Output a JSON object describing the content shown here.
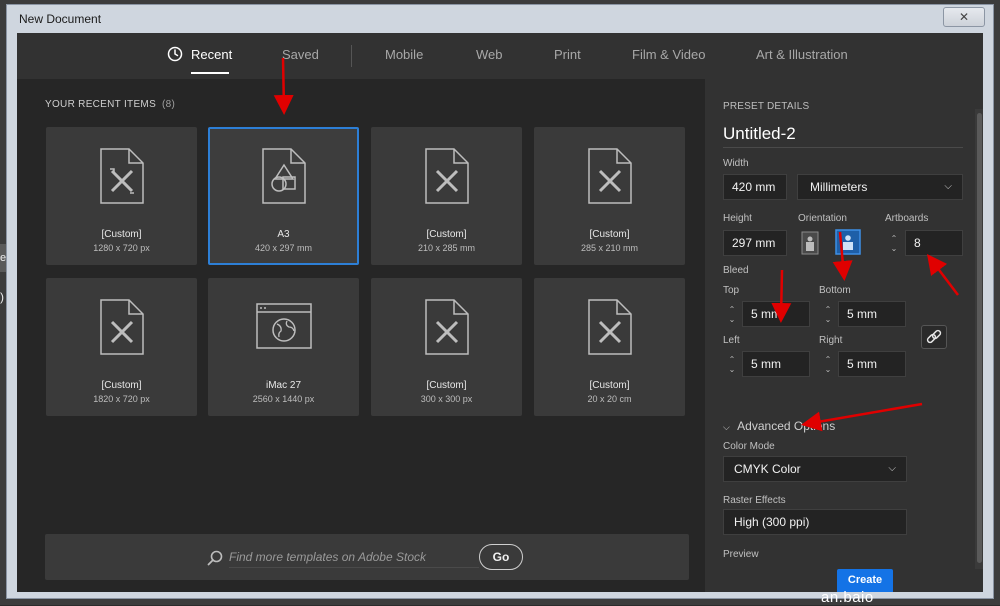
{
  "window": {
    "title": "New Document",
    "close_glyph": "✕"
  },
  "background": {
    "stub_text": "ew",
    "stub_paren": ")"
  },
  "tabs": [
    {
      "label": "Recent",
      "active": true,
      "icon": "clock-icon"
    },
    {
      "label": "Saved"
    },
    {
      "label": "Mobile"
    },
    {
      "label": "Web"
    },
    {
      "label": "Print"
    },
    {
      "label": "Film & Video"
    },
    {
      "label": "Art & Illustration"
    }
  ],
  "recent": {
    "heading": "YOUR RECENT ITEMS",
    "count": "(8)",
    "items": [
      {
        "name": "[Custom]",
        "size": "1280 x 720 px",
        "icon": "document-brush-icon"
      },
      {
        "name": "A3",
        "size": "420 x 297 mm",
        "icon": "document-shapes-icon",
        "selected": true
      },
      {
        "name": "[Custom]",
        "size": "210 x 285 mm",
        "icon": "document-brush-icon"
      },
      {
        "name": "[Custom]",
        "size": "285 x 210 mm",
        "icon": "document-brush-icon"
      },
      {
        "name": "[Custom]",
        "size": "1820 x 720 px",
        "icon": "document-brush-icon"
      },
      {
        "name": "iMac 27",
        "size": "2560 x 1440 px",
        "icon": "web-globe-icon"
      },
      {
        "name": "[Custom]",
        "size": "300 x 300 px",
        "icon": "document-brush-icon"
      },
      {
        "name": "[Custom]",
        "size": "20 x 20 cm",
        "icon": "document-brush-icon"
      }
    ]
  },
  "search": {
    "placeholder": "Find more templates on Adobe Stock",
    "go_label": "Go"
  },
  "preset": {
    "heading": "PRESET DETAILS",
    "name": "Untitled-2",
    "width_label": "Width",
    "width_value": "420 mm",
    "units_value": "Millimeters",
    "height_label": "Height",
    "height_value": "297 mm",
    "orientation_label": "Orientation",
    "artboards_label": "Artboards",
    "artboards_value": "8",
    "bleed_label": "Bleed",
    "top_label": "Top",
    "top_value": "5 mm",
    "bottom_label": "Bottom",
    "bottom_value": "5 mm",
    "left_label": "Left",
    "left_value": "5 mm",
    "right_label": "Right",
    "right_value": "5 mm",
    "advanced_label": "Advanced Options",
    "color_mode_label": "Color Mode",
    "color_mode_value": "CMYK Color",
    "raster_label": "Raster Effects",
    "raster_value": "High (300 ppi)",
    "preview_label": "Preview",
    "create_label": "Create"
  },
  "watermark": {
    "text": "an.baio"
  },
  "colors": {
    "accent": "#2d7fd6",
    "create": "#1473e6",
    "annotation": "#e00000"
  }
}
